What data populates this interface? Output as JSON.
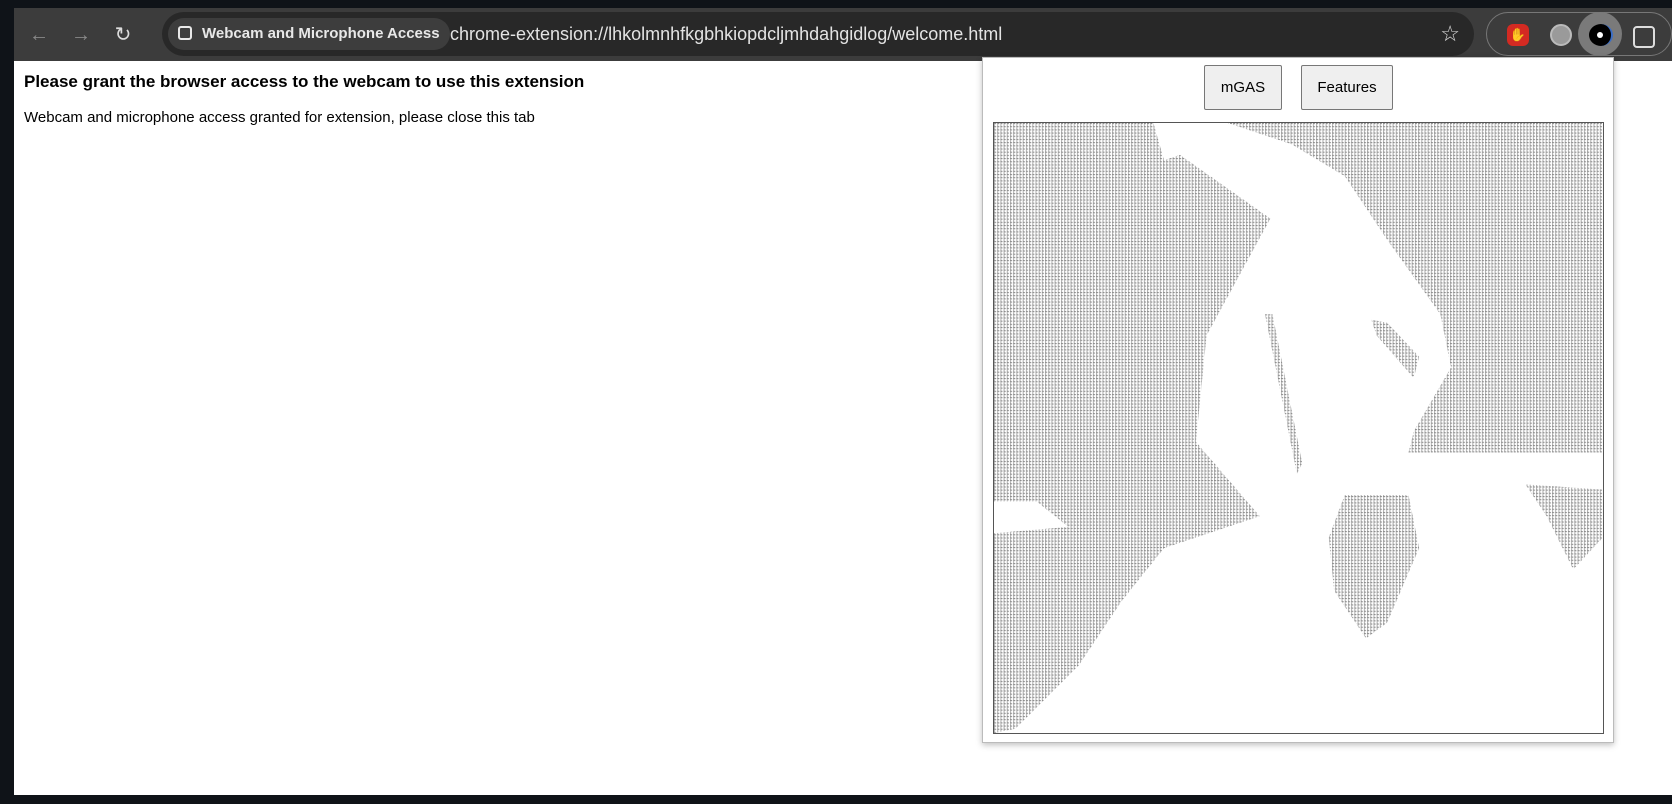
{
  "browser": {
    "tab_chip_label": "Webcam and Microphone Access",
    "url": "chrome-extension://lhkolmnhfkgbhkiopdcljmhdahgidlog/welcome.html",
    "icons": [
      "back-arrow-icon",
      "forward-arrow-icon",
      "reload-icon",
      "extension-icon",
      "star-icon",
      "stop-hand-icon",
      "globe-icon",
      "webcam-extension-icon",
      "puzzle-icon"
    ],
    "glyphs": {
      "back": "←",
      "forward": "→",
      "reload": "↻",
      "star": "☆",
      "hand": "✋"
    }
  },
  "page": {
    "heading": "Please grant the browser access to the webcam to use this extension",
    "message": "Webcam and microphone access granted for extension, please close this tab"
  },
  "popup": {
    "buttons": [
      "mGAS",
      "Features"
    ]
  }
}
